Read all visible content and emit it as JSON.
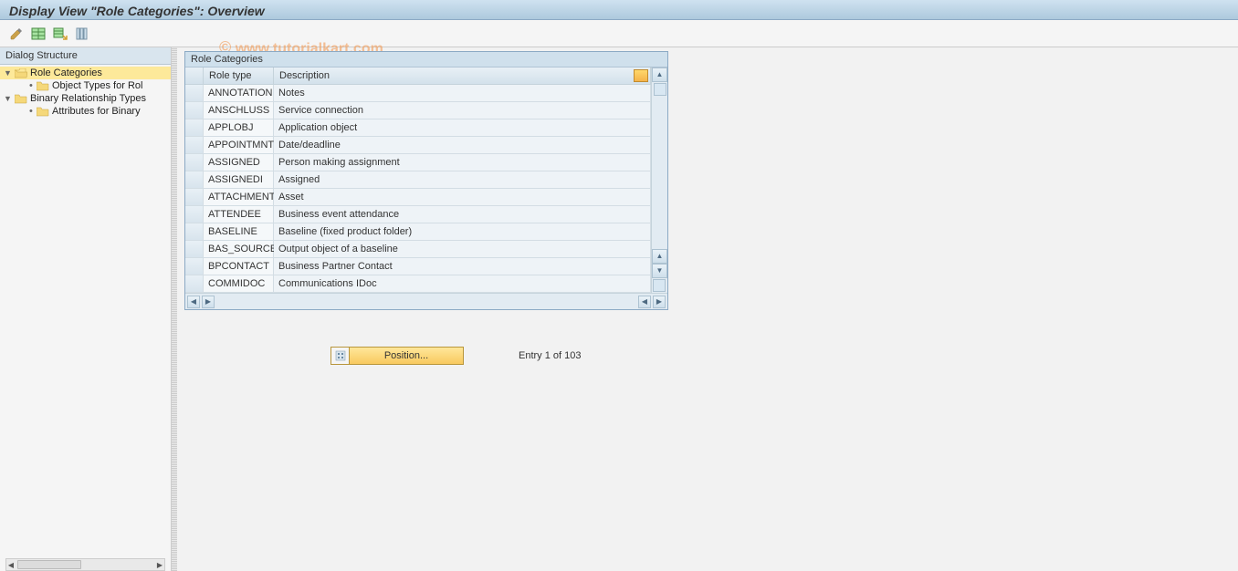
{
  "title": "Display View \"Role Categories\": Overview",
  "watermark": "www.tutorialkart.com",
  "toolbar": {
    "icons": [
      "edit-icon",
      "table-icon",
      "table-export-icon",
      "columns-icon"
    ]
  },
  "sidebar": {
    "header": "Dialog Structure",
    "items": [
      {
        "label": "Role Categories",
        "level": 1,
        "selected": true,
        "expandable": true
      },
      {
        "label": "Object Types for Rol",
        "level": 2,
        "selected": false,
        "expandable": false
      },
      {
        "label": "Binary Relationship Types",
        "level": 1,
        "selected": false,
        "expandable": true
      },
      {
        "label": "Attributes for Binary",
        "level": 2,
        "selected": false,
        "expandable": false
      }
    ]
  },
  "table": {
    "title": "Role Categories",
    "columns": {
      "roletype": "Role type",
      "description": "Description"
    },
    "rows": [
      {
        "roletype": "ANNOTATION",
        "description": "Notes"
      },
      {
        "roletype": "ANSCHLUSS",
        "description": "Service connection"
      },
      {
        "roletype": "APPLOBJ",
        "description": "Application object"
      },
      {
        "roletype": "APPOINTMNT",
        "description": "Date/deadline"
      },
      {
        "roletype": "ASSIGNED",
        "description": "Person making assignment"
      },
      {
        "roletype": "ASSIGNEDI",
        "description": "Assigned"
      },
      {
        "roletype": "ATTACHMENT",
        "description": "Asset"
      },
      {
        "roletype": "ATTENDEE",
        "description": "Business event attendance"
      },
      {
        "roletype": "BASELINE",
        "description": "Baseline (fixed product folder)"
      },
      {
        "roletype": "BAS_SOURCE",
        "description": "Output object of a baseline"
      },
      {
        "roletype": "BPCONTACT",
        "description": "Business Partner Contact"
      },
      {
        "roletype": "COMMIDOC",
        "description": "Communications IDoc"
      }
    ]
  },
  "footer": {
    "position_button": "Position...",
    "entry_text": "Entry 1 of 103"
  }
}
